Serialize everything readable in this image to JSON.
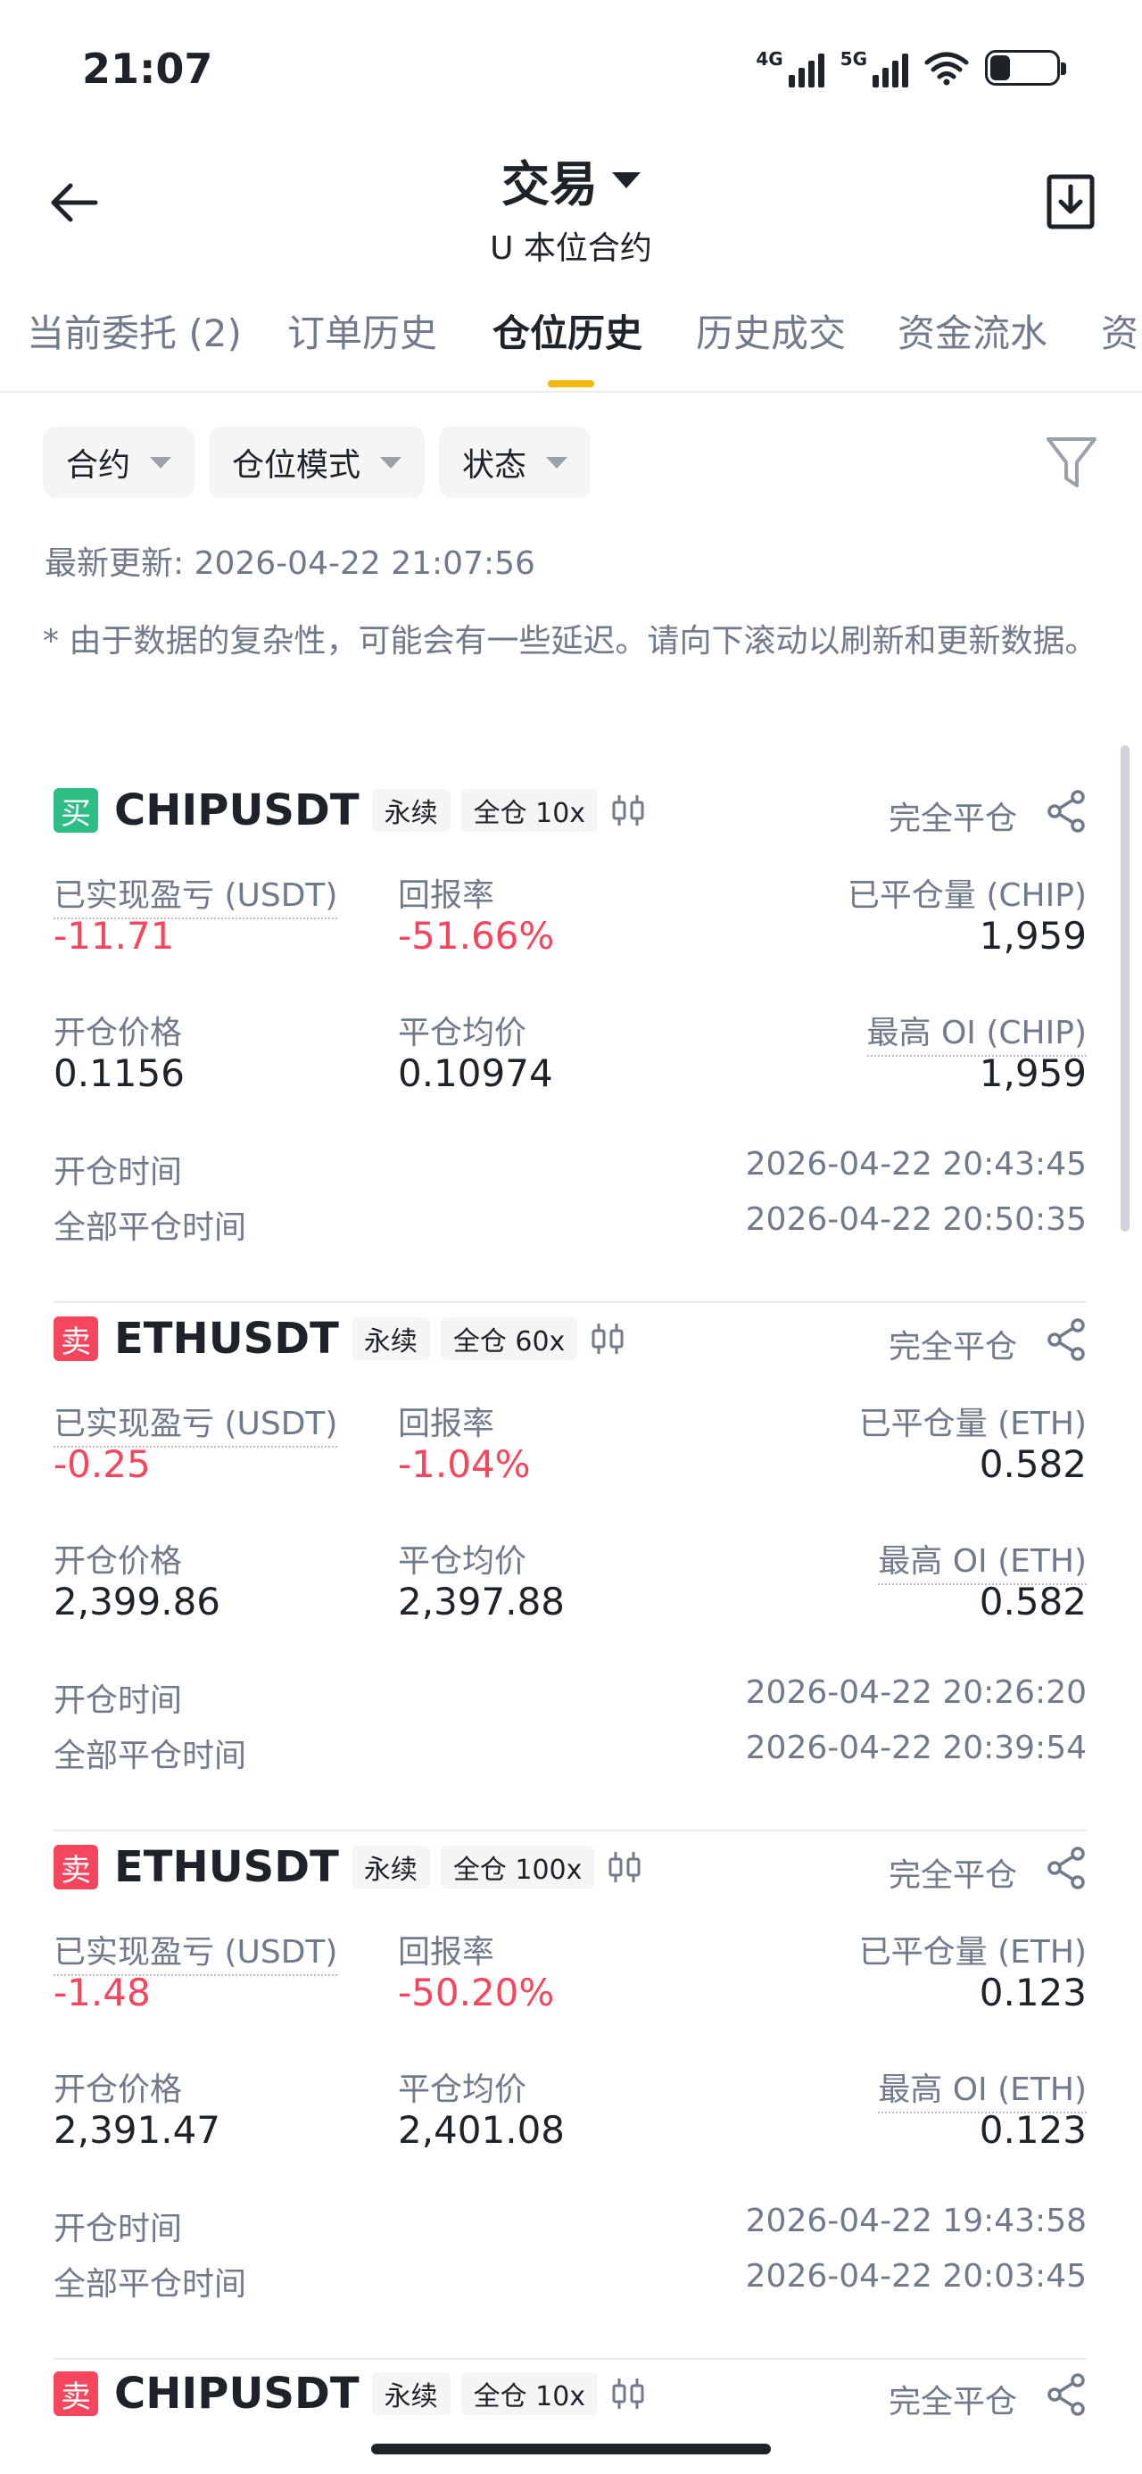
{
  "status_bar": {
    "time": "21:07",
    "net1": "4G",
    "net2": "5G",
    "battery": "27"
  },
  "header": {
    "title": "交易",
    "subtitle": "U 本位合约"
  },
  "tabs": [
    {
      "label": "当前委托 (2)"
    },
    {
      "label": "订单历史"
    },
    {
      "label": "仓位历史"
    },
    {
      "label": "历史成交"
    },
    {
      "label": "资金流水"
    },
    {
      "label": "资"
    }
  ],
  "filters": {
    "contract": "合约",
    "position_mode": "仓位模式",
    "status": "状态"
  },
  "last_update": "最新更新: 2026-04-22 21:07:56",
  "notice": "* 由于数据的复杂性，可能会有一些延迟。请向下滚动以刷新和更新数据。",
  "labels": {
    "realized_pnl": "已实现盈亏 (USDT)",
    "roi": "回报率",
    "entry_price": "开仓价格",
    "close_avg_price": "平仓均价",
    "open_time": "开仓时间",
    "close_time": "全部平仓时间"
  },
  "positions": [
    {
      "side": "买",
      "symbol": "CHIPUSDT",
      "type": "永续",
      "leverage": "全仓 10x",
      "status": "完全平仓",
      "pnl": "-11.71",
      "roi": "-51.66%",
      "closed_qty_label": "已平仓量 (CHIP)",
      "closed_qty": "1,959",
      "entry_price": "0.1156",
      "close_avg": "0.10974",
      "max_oi_label": "最高 OI (CHIP)",
      "max_oi": "1,959",
      "open_time": "2026-04-22 20:43:45",
      "close_time": "2026-04-22 20:50:35"
    },
    {
      "side": "卖",
      "symbol": "ETHUSDT",
      "type": "永续",
      "leverage": "全仓 60x",
      "status": "完全平仓",
      "pnl": "-0.25",
      "roi": "-1.04%",
      "closed_qty_label": "已平仓量 (ETH)",
      "closed_qty": "0.582",
      "entry_price": "2,399.86",
      "close_avg": "2,397.88",
      "max_oi_label": "最高 OI (ETH)",
      "max_oi": "0.582",
      "open_time": "2026-04-22 20:26:20",
      "close_time": "2026-04-22 20:39:54"
    },
    {
      "side": "卖",
      "symbol": "ETHUSDT",
      "type": "永续",
      "leverage": "全仓 100x",
      "status": "完全平仓",
      "pnl": "-1.48",
      "roi": "-50.20%",
      "closed_qty_label": "已平仓量 (ETH)",
      "closed_qty": "0.123",
      "entry_price": "2,391.47",
      "close_avg": "2,401.08",
      "max_oi_label": "最高 OI (ETH)",
      "max_oi": "0.123",
      "open_time": "2026-04-22 19:43:58",
      "close_time": "2026-04-22 20:03:45"
    },
    {
      "side": "卖",
      "symbol": "CHIPUSDT",
      "type": "永续",
      "leverage": "全仓 10x",
      "status": "完全平仓"
    }
  ],
  "colors": {
    "accent": "#f0b90b",
    "buy": "#2ebd85",
    "sell": "#f6465d",
    "muted": "#707a8a"
  },
  "icons": {
    "back": "arrow-left-icon",
    "download": "download-icon",
    "filter": "funnel-icon",
    "candle": "candlestick-icon",
    "share": "share-icon"
  }
}
